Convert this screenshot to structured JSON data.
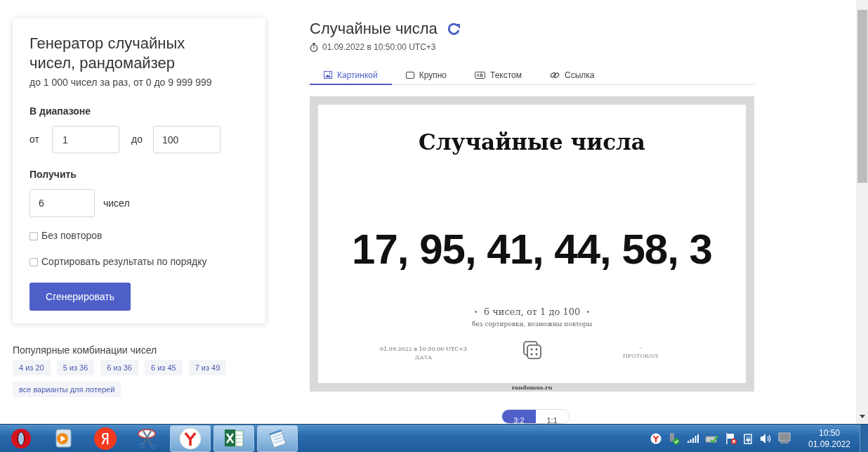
{
  "form": {
    "title": "Генератор случайных чисел, рандомайзер",
    "subtitle": "до 1 000 чисел за раз, от 0 до 9 999 999",
    "range_label": "В диапазоне",
    "from_label": "от",
    "from_value": "1",
    "to_label": "до",
    "to_value": "100",
    "count_label": "Получить",
    "count_value": "6",
    "count_unit": "чисел",
    "options": [
      {
        "label": "Без повторов",
        "checked": false
      },
      {
        "label": "Сортировать результаты по порядку",
        "checked": false
      }
    ],
    "button": "Сгенерировать"
  },
  "popular": {
    "title": "Популярные комбинации чисел",
    "tags": [
      "4 из 20",
      "5 из 36",
      "6 из 36",
      "6 из 45",
      "7 из 49",
      "все варианты для лотерей"
    ]
  },
  "result": {
    "title": "Случайные числа",
    "timestamp": "01.09.2022 в 10:50:00 UTC+3",
    "tabs": [
      {
        "kind": "image",
        "label": "Картинкой",
        "selected": true
      },
      {
        "kind": "large",
        "label": "Крупно",
        "selected": false
      },
      {
        "kind": "text",
        "label": "Текстом",
        "selected": false
      },
      {
        "kind": "link",
        "label": "Ссылка",
        "selected": false
      }
    ],
    "image": {
      "heading": "Случайные числа",
      "numbers": "17, 95, 41, 44, 58, 3",
      "summary": "6 чисел, от 1 до 100",
      "details": "без сортировки, возможны повторы",
      "date": "01.09.2022 в 10:50:00 UTC+3",
      "date_label": "ДАТА",
      "protocol": "–",
      "protocol_label": "ПРОТОКОЛ",
      "site": "randomus.ru"
    },
    "ratios": [
      {
        "label": "3:2",
        "selected": true
      },
      {
        "label": "1:1",
        "selected": false
      }
    ]
  },
  "taskbar": {
    "apps": [
      {
        "kind": "opera",
        "open": false
      },
      {
        "kind": "player",
        "open": false
      },
      {
        "kind": "yandex",
        "open": false
      },
      {
        "kind": "scissors",
        "open": false
      },
      {
        "kind": "yandex-browser",
        "open": true
      },
      {
        "kind": "excel",
        "open": true
      },
      {
        "kind": "notepad",
        "open": true
      }
    ],
    "clock": {
      "time": "10:50",
      "date": "01.09.2022"
    }
  }
}
